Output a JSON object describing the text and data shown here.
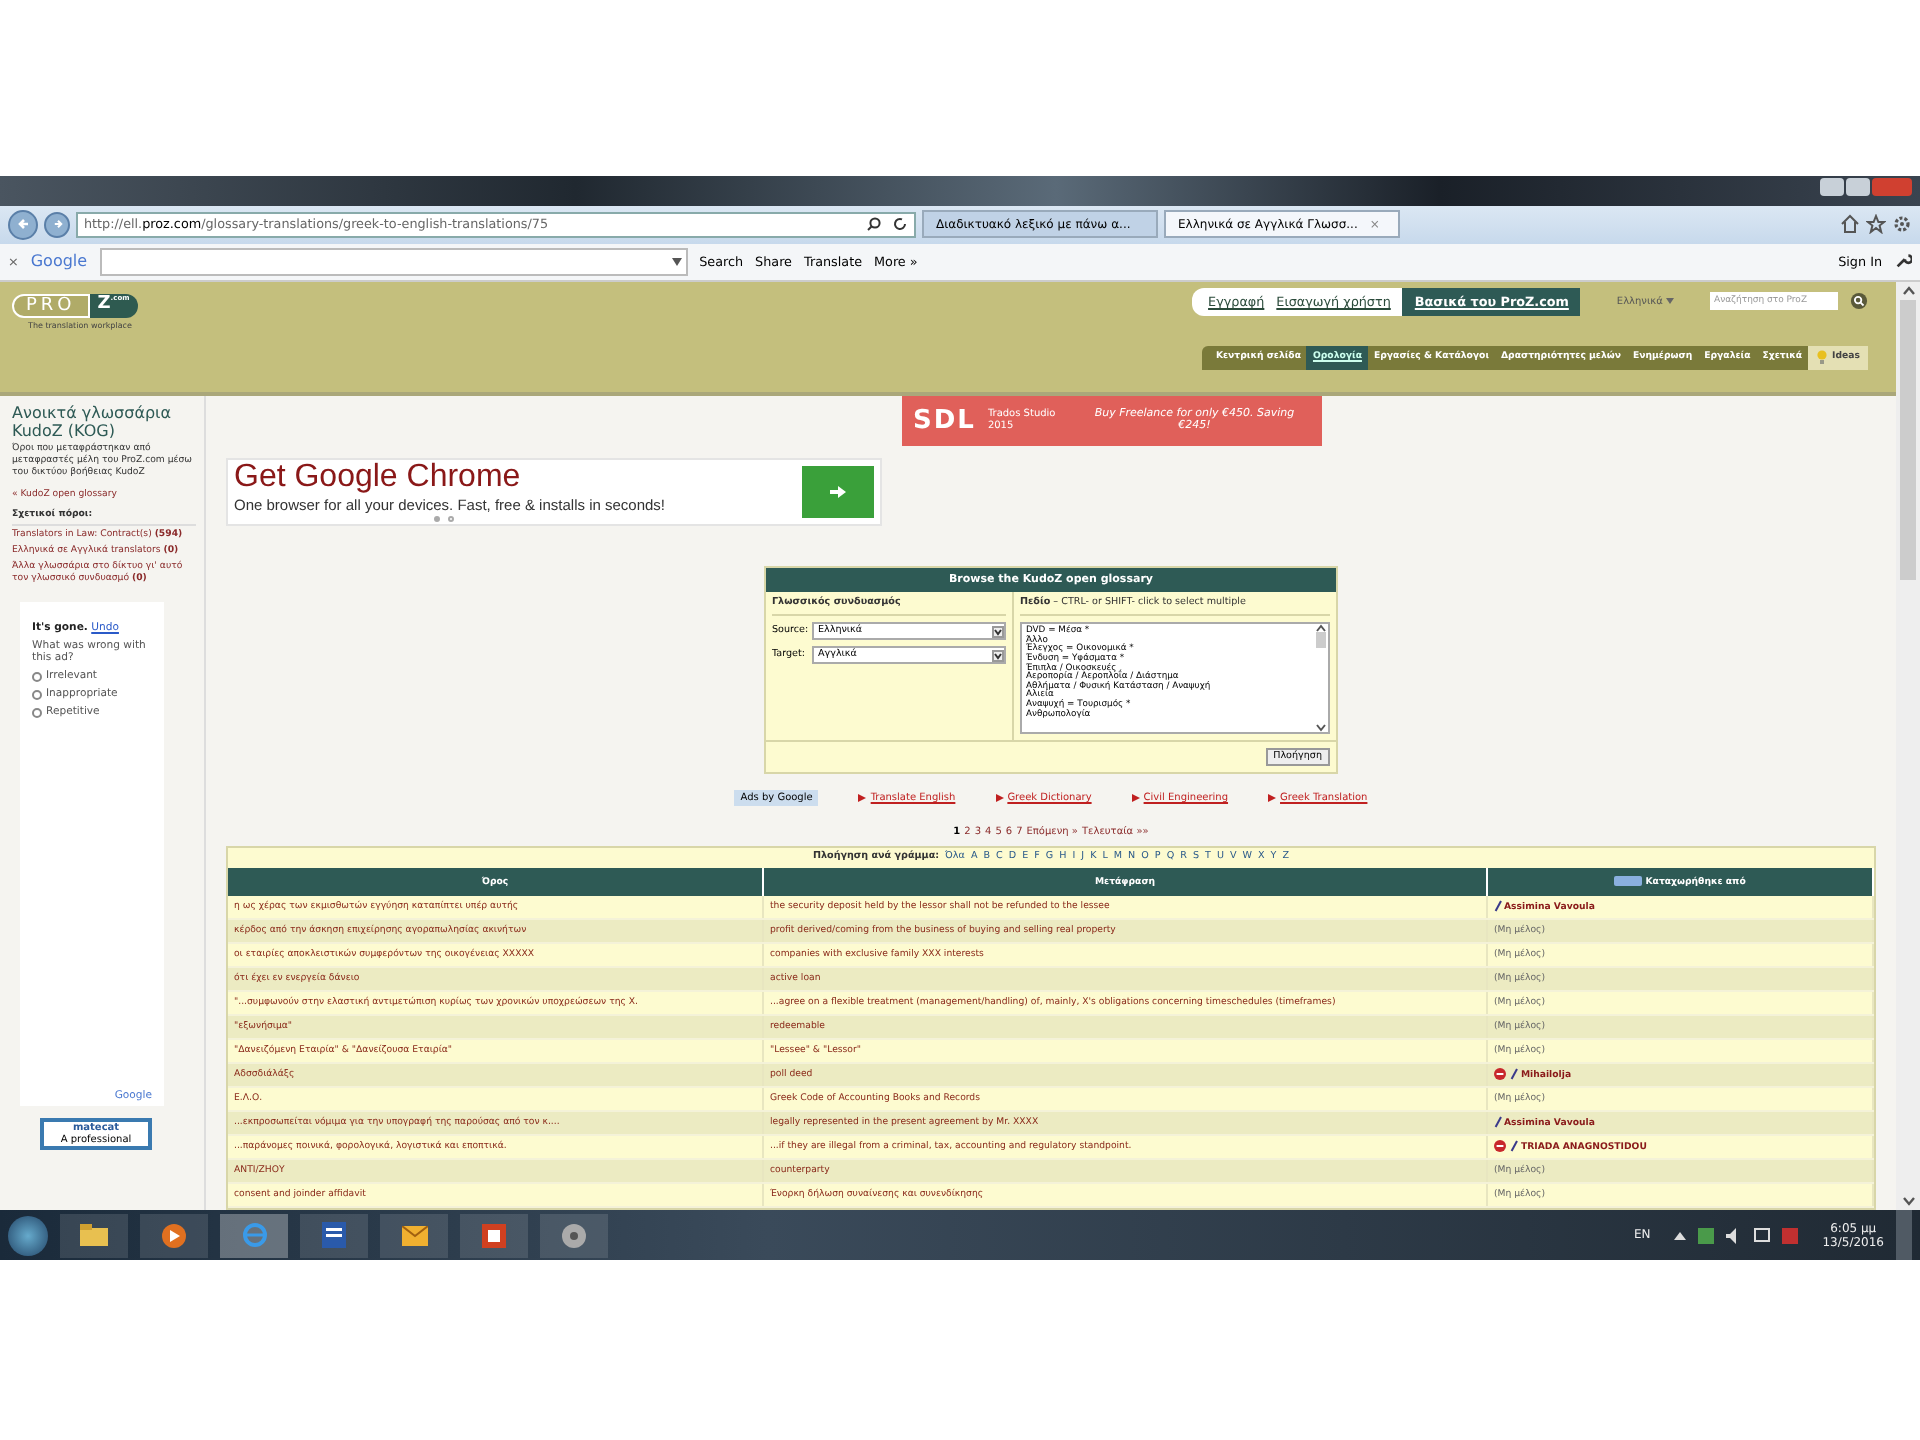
{
  "browser": {
    "address": {
      "prefix": "http://ell.",
      "domain": "proz.com",
      "path": "/glossary-translations/greek-to-english-translations/75"
    },
    "tabs": [
      {
        "title": "Διαδικτυακό λεξικό με πάνω α...",
        "selected": false
      },
      {
        "title": "Ελληνικά σε Αγγλικά Γλωσσ...",
        "selected": true
      }
    ],
    "close_tab": "×"
  },
  "google_toolbar": {
    "close": "×",
    "brand": "Google",
    "items": [
      "Search",
      "Share",
      "Translate",
      "More »"
    ],
    "sign_in": "Sign In"
  },
  "site_header": {
    "logo": {
      "left": "PRO",
      "right": "Z",
      "sup": ".com",
      "tagline": "The translation workplace"
    },
    "links": [
      "Εγγραφή",
      "Εισαγωγή χρήστη"
    ],
    "highlight_link": "Βασικά του ProZ.com",
    "language": "Ελληνικά",
    "search": {
      "placeholder": "Αναζήτηση στο ProZ"
    },
    "nav": [
      {
        "label": "Κεντρική σελίδα",
        "selected": false
      },
      {
        "label": "Ορολογία",
        "selected": true
      },
      {
        "label": "Εργασίες & Κατάλογοι",
        "selected": false
      },
      {
        "label": "Δραστηριότητες μελών",
        "selected": false
      },
      {
        "label": "Ενημέρωση",
        "selected": false
      },
      {
        "label": "Εργαλεία",
        "selected": false
      },
      {
        "label": "Σχετικά",
        "selected": false
      }
    ],
    "ideas": "Ideas"
  },
  "sidebar": {
    "title": "Ανοικτά γλωσσάρια KudoZ (KOG)",
    "description": "Όροι που μεταφράστηκαν από μεταφραστές μέλη του ProZ.com μέσω του δικτύου βοήθειας KudoZ",
    "back_link": "« KudoZ open glossary",
    "resources_heading": "Σχετικοί πόροι:",
    "resources": [
      {
        "label": "Translators in Law: Contract(s)",
        "count": "(594)"
      },
      {
        "label": "Ελληνικά σε Αγγλικά translators",
        "count": "(0)"
      },
      {
        "label": "Άλλα γλωσσάρια στο δίκτυο γι' αυτό τον γλωσσικό συνδυασμό",
        "count": "(0)"
      }
    ],
    "ad_feedback": {
      "status": "It's gone.",
      "undo": "Undo",
      "question": "What was wrong with this ad?",
      "options": [
        {
          "label": "Irrelevant",
          "selected": false
        },
        {
          "label": "Inappropriate",
          "selected": false
        },
        {
          "label": "Repetitive",
          "selected": false
        }
      ],
      "brand": "Google"
    },
    "ad": {
      "brand": "matecat",
      "text": "A professional"
    }
  },
  "sdl_banner": {
    "brand": "SDL",
    "product": "Trados Studio 2015",
    "offer": "Buy Freelance for only €450. Saving €245!"
  },
  "chrome_ad": {
    "title": "Get Google Chrome",
    "text": "One browser for all your devices. Fast, free & installs in seconds!",
    "dots": [
      {
        "selected": true
      },
      {
        "selected": false
      }
    ]
  },
  "browse_form": {
    "title": "Browse the KudoZ open glossary",
    "pair_heading": "Γλωσσικός συνδυασμός",
    "field_heading": "Πεδίο",
    "field_hint": "– CTRL- or SHIFT- click to select multiple",
    "source": {
      "label": "Source:",
      "value": "Ελληνικά"
    },
    "target": {
      "label": "Target:",
      "value": "Αγγλικά"
    },
    "fields": [
      "DVD = Μέσα *",
      "Άλλο",
      "Έλεγχος = Οικονομικά *",
      "Ένδυση = Υφάσματα *",
      "Έπιπλα / Οικοσκευές",
      "Αεροπορία / Αεροπλοΐα / Διάστημα",
      "Αθλήματα / Φυσική Κατάσταση / Αναψυχή",
      "Αλιεία",
      "Αναψυχή = Τουρισμός *",
      "Ανθρωπολογία"
    ],
    "button": "Πλοήγηση"
  },
  "ads_row": {
    "label": "Ads by Google",
    "links": [
      "Translate English",
      "Greek Dictionary",
      "Civil Engineering",
      "Greek Translation"
    ]
  },
  "pagination": {
    "pages": [
      {
        "label": "1",
        "selected": true
      },
      {
        "label": "2",
        "selected": false
      },
      {
        "label": "3",
        "selected": false
      },
      {
        "label": "4",
        "selected": false
      },
      {
        "label": "5",
        "selected": false
      },
      {
        "label": "6",
        "selected": false
      },
      {
        "label": "7",
        "selected": false
      }
    ],
    "next": "Επόμενη »",
    "last": "Τελευταία »»"
  },
  "letter_nav": {
    "label": "Πλοήγηση ανά γράμμα:",
    "letters": [
      "Όλα",
      "A",
      "B",
      "C",
      "D",
      "E",
      "F",
      "G",
      "H",
      "I",
      "J",
      "K",
      "L",
      "M",
      "N",
      "O",
      "P",
      "Q",
      "R",
      "S",
      "T",
      "U",
      "V",
      "W",
      "X",
      "Y",
      "Z"
    ]
  },
  "table": {
    "columns": [
      "Όρος",
      "Μετάφραση",
      "Καταχωρήθηκε από"
    ],
    "rows": [
      {
        "term": "η ως χέρας των εκμισθωτών εγγύηση καταπίπτει υπέρ αυτής",
        "translation": "the security deposit held by the lessor shall not be refunded to the lessee",
        "submitter": "Assimina Vavoula",
        "member": true,
        "flagged": false
      },
      {
        "term": "κέρδος από την άσκηση επιχείρησης αγοραπωλησίας ακινήτων",
        "translation": "profit derived/coming from the business of buying and selling real property",
        "submitter": "(Μη μέλος)",
        "member": false,
        "flagged": false
      },
      {
        "term": "οι εταιρίες αποκλειστικών συμφερόντων της οικογένειας XXXXX",
        "translation": "companies with exclusive family XXX interests",
        "submitter": "(Μη μέλος)",
        "member": false,
        "flagged": false
      },
      {
        "term": "ότι έχει εν ενεργεία δάνειο",
        "translation": "active loan",
        "submitter": "(Μη μέλος)",
        "member": false,
        "flagged": false
      },
      {
        "term": "\"...συμφωνούν στην ελαστική αντιμετώπιση κυρίως των χρονικών υποχρεώσεων της Χ.",
        "translation": "...agree on a flexible treatment (management/handling) of, mainly, X's obligations concerning timeschedules (timeframes)",
        "submitter": "(Μη μέλος)",
        "member": false,
        "flagged": false
      },
      {
        "term": "\"εξωνήσιμα\"",
        "translation": "redeemable",
        "submitter": "(Μη μέλος)",
        "member": false,
        "flagged": false
      },
      {
        "term": "\"Δανειζόμενη Εταιρία\" & \"Δανείζουσα Εταιρία\"",
        "translation": "\"Lessee\" & \"Lessor\"",
        "submitter": "(Μη μέλος)",
        "member": false,
        "flagged": false
      },
      {
        "term": "Αδσσδιάλάξς",
        "translation": "poll deed",
        "submitter": "Mihailolja",
        "member": true,
        "flagged": true
      },
      {
        "term": "Ε.Λ.Ο.",
        "translation": "Greek Code of Accounting Books and Records",
        "submitter": "(Μη μέλος)",
        "member": false,
        "flagged": false
      },
      {
        "term": "...εκπροσωπείται νόμιμα για την υπογραφή της παρούσας από τον κ....",
        "translation": "legally represented in the present agreement by Mr. XXXX",
        "submitter": "Assimina Vavoula",
        "member": true,
        "flagged": false
      },
      {
        "term": "...παράνομες ποινικά, φορολογικά, λογιστικά και εποπτικά.",
        "translation": "...if they are illegal from a criminal, tax, accounting and regulatory standpoint.",
        "submitter": "TRIADA ANAGNOSTIDOU",
        "member": true,
        "flagged": true
      },
      {
        "term": "ANTI/ΖΗΟΥ",
        "translation": "counterparty",
        "submitter": "(Μη μέλος)",
        "member": false,
        "flagged": false
      },
      {
        "term": "consent and joinder affidavit",
        "translation": "Ένορκη δήλωση συναίνεσης και συνενδίκησης",
        "submitter": "(Μη μέλος)",
        "member": false,
        "flagged": false
      }
    ]
  },
  "taskbar": {
    "language": "EN",
    "time": "6:05 μμ",
    "date": "13/5/2016"
  }
}
